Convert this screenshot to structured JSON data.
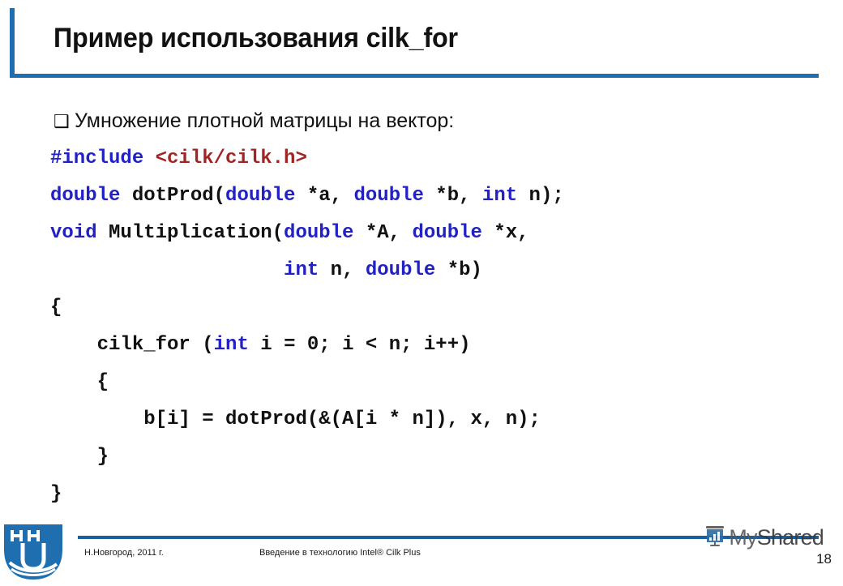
{
  "slide": {
    "title": "Пример использования cilk_for",
    "page_number": "18"
  },
  "accent_colors": {
    "header_bar": "#1f6fb0",
    "footer_rule": "#1b5f9e",
    "keyword_blue": "#2222c4",
    "header_path_red": "#a02626",
    "logo_blue": "#1f6fb0"
  },
  "body": {
    "bullet_marker": "❑",
    "bullet_text": "Умножение плотной матрицы на вектор:",
    "code_lines": [
      {
        "id": "line-include",
        "segments": [
          {
            "text": "#include ",
            "style": "inc"
          },
          {
            "text": "<cilk/cilk.h>",
            "style": "hdr"
          }
        ]
      },
      {
        "id": "line-dotprod-decl",
        "segments": [
          {
            "text": "double",
            "style": "kw"
          },
          {
            "text": " dotProd(",
            "style": ""
          },
          {
            "text": "double",
            "style": "kw"
          },
          {
            "text": " *a, ",
            "style": ""
          },
          {
            "text": "double",
            "style": "kw"
          },
          {
            "text": " *b, ",
            "style": ""
          },
          {
            "text": "int",
            "style": "kw"
          },
          {
            "text": " n);",
            "style": ""
          }
        ]
      },
      {
        "id": "line-mult-decl-1",
        "segments": [
          {
            "text": "void",
            "style": "kw"
          },
          {
            "text": " Multiplication(",
            "style": ""
          },
          {
            "text": "double",
            "style": "kw"
          },
          {
            "text": " *A, ",
            "style": ""
          },
          {
            "text": "double",
            "style": "kw"
          },
          {
            "text": " *x,",
            "style": ""
          }
        ]
      },
      {
        "id": "line-mult-decl-2",
        "segments": [
          {
            "text": "                    ",
            "style": ""
          },
          {
            "text": "int",
            "style": "kw"
          },
          {
            "text": " n, ",
            "style": ""
          },
          {
            "text": "double",
            "style": "kw"
          },
          {
            "text": " *b)",
            "style": ""
          }
        ]
      },
      {
        "id": "line-open-brace",
        "segments": [
          {
            "text": "{",
            "style": ""
          }
        ]
      },
      {
        "id": "line-cilk-for",
        "segments": [
          {
            "text": "    cilk_for (",
            "style": ""
          },
          {
            "text": "int",
            "style": "kw"
          },
          {
            "text": " i = 0; i < n; i++)",
            "style": ""
          }
        ]
      },
      {
        "id": "line-inner-open",
        "segments": [
          {
            "text": "    {",
            "style": ""
          }
        ]
      },
      {
        "id": "line-body",
        "segments": [
          {
            "text": "        b[i] = dotProd(&(A[i * n]), x, n);",
            "style": ""
          }
        ]
      },
      {
        "id": "line-inner-close",
        "segments": [
          {
            "text": "    }",
            "style": ""
          }
        ]
      },
      {
        "id": "line-close-brace",
        "segments": [
          {
            "text": "}",
            "style": ""
          }
        ]
      }
    ]
  },
  "footer": {
    "left_text": "Н.Новгород, 2011 г.",
    "center_text": "Введение в технологию Intel® Cilk Plus",
    "logo_label": "unn-logo",
    "watermark_my": "My",
    "watermark_shared": "Shared"
  }
}
